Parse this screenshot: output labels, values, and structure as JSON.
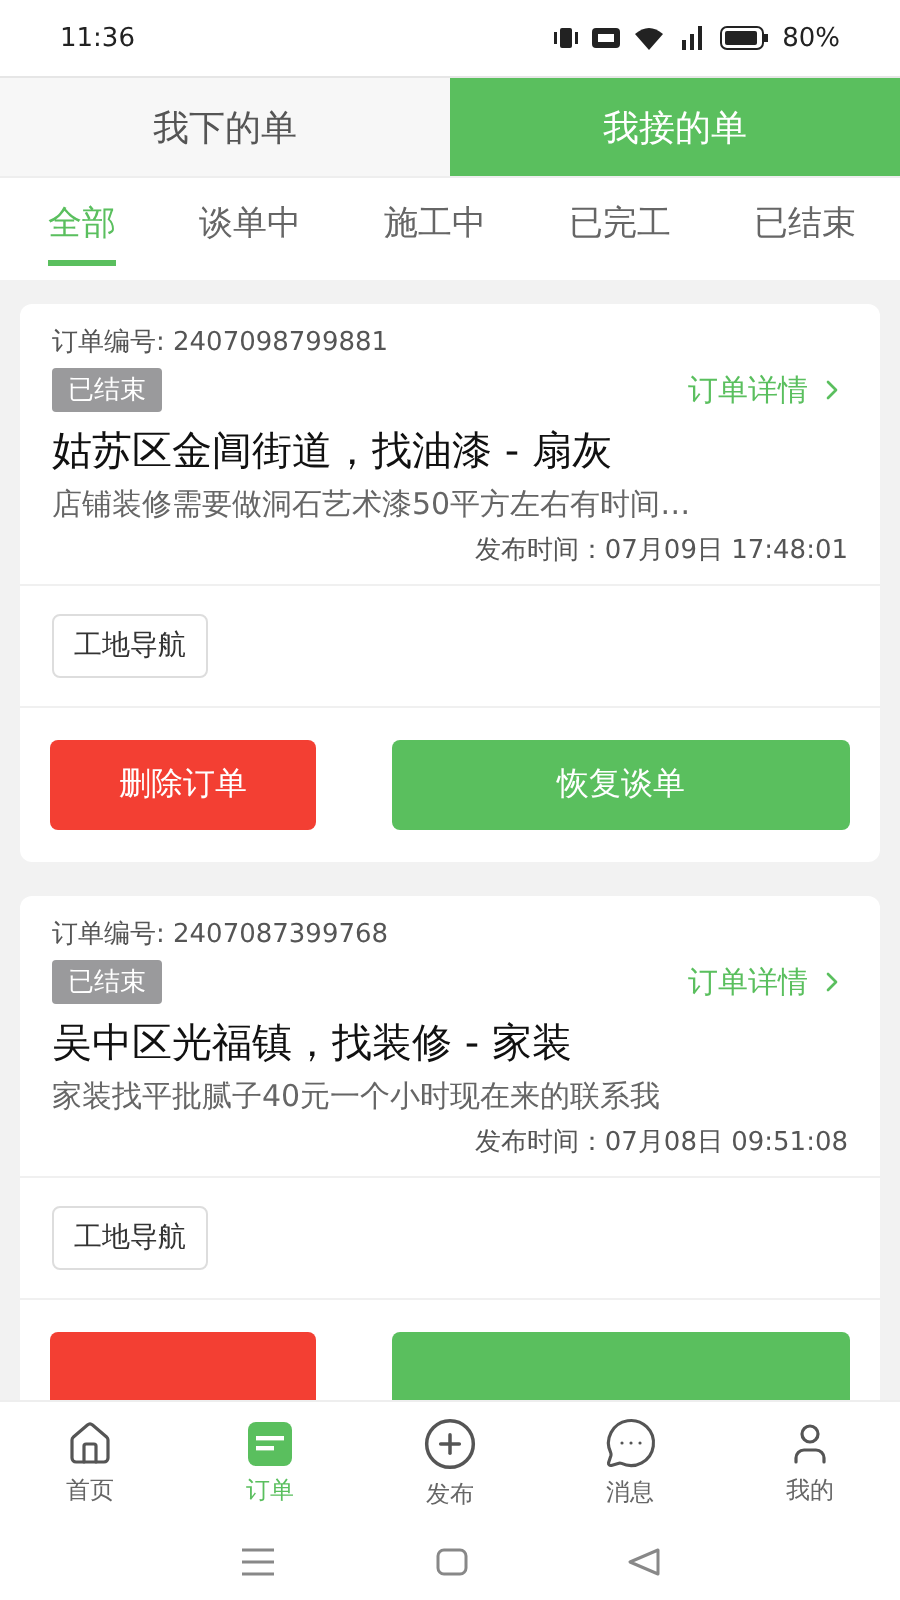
{
  "status_bar": {
    "time": "11:36",
    "battery": "80%"
  },
  "top_tabs": [
    {
      "label": "我下的单",
      "selected": false
    },
    {
      "label": "我接的单",
      "selected": true
    }
  ],
  "filter_tabs": [
    {
      "label": "全部",
      "selected": true
    },
    {
      "label": "谈单中",
      "selected": false
    },
    {
      "label": "施工中",
      "selected": false
    },
    {
      "label": "已完工",
      "selected": false
    },
    {
      "label": "已结束",
      "selected": false
    }
  ],
  "orders": [
    {
      "order_no": "订单编号: 2407098799881",
      "status": "已结束",
      "detail_link": "订单详情",
      "title": "姑苏区金阊街道，找油漆 - 扇灰",
      "description": "店铺装修需要做洞石艺术漆50平方左右有时间…",
      "published": "发布时间：07月09日  17:48:01",
      "nav_button": "工地导航",
      "buttons": [
        {
          "kind": "delete",
          "label": "删除订单"
        },
        {
          "kind": "restore",
          "label": "恢复谈单"
        }
      ]
    },
    {
      "order_no": "订单编号: 2407087399768",
      "status": "已结束",
      "detail_link": "订单详情",
      "title": "吴中区光福镇，找装修 - 家装",
      "description": "家装找平批腻子40元一个小时现在来的联系我",
      "published": "发布时间：07月08日  09:51:08",
      "nav_button": "工地导航",
      "buttons": [
        {
          "kind": "delete"
        },
        {
          "kind": "restore"
        }
      ]
    }
  ],
  "bottom_nav": [
    {
      "label": "首页",
      "kind": "home",
      "selected": false
    },
    {
      "label": "订单",
      "kind": "orders",
      "selected": true
    },
    {
      "label": "发布",
      "kind": "publish",
      "selected": false
    },
    {
      "label": "消息",
      "kind": "messages",
      "selected": false
    },
    {
      "label": "我的",
      "kind": "profile",
      "selected": false
    }
  ]
}
